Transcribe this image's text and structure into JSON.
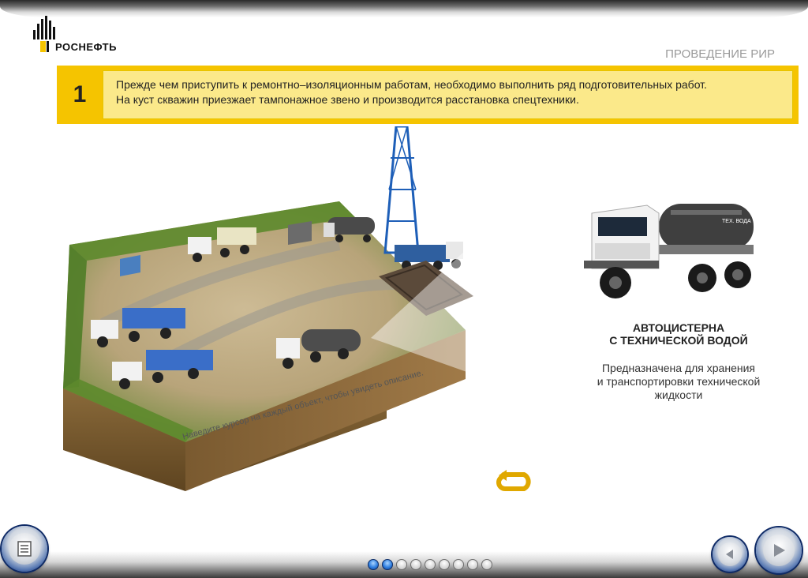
{
  "header": {
    "brand": "РОСНЕФТЬ",
    "section_title": "ПРОВЕДЕНИЕ РИР"
  },
  "step": {
    "number": "1",
    "text_line1": "Прежде чем приступить к ремонтно–изоляционным работам, необходимо выполнить ряд подготовительных работ.",
    "text_line2": "На куст скважин приезжает тампонажное звено и производится расстановка спецтехники."
  },
  "scene": {
    "hint": "Наведите курсор на каждый объект, чтобы увидеть описание.",
    "truck_label": "ТЕХ. ВОДА"
  },
  "info": {
    "title_line1": "АВТОЦИСТЕРНА",
    "title_line2": "С ТЕХНИЧЕСКОЙ ВОДОЙ",
    "desc_line1": "Предназначена для хранения",
    "desc_line2": "и транспортировки технической",
    "desc_line3": "жидкости"
  },
  "nav": {
    "total_pages": 9,
    "active_pages": [
      1,
      2
    ]
  },
  "colors": {
    "accent": "#f5c400",
    "accent_light": "#fbe98a",
    "nav_blue": "#1b3c86"
  }
}
